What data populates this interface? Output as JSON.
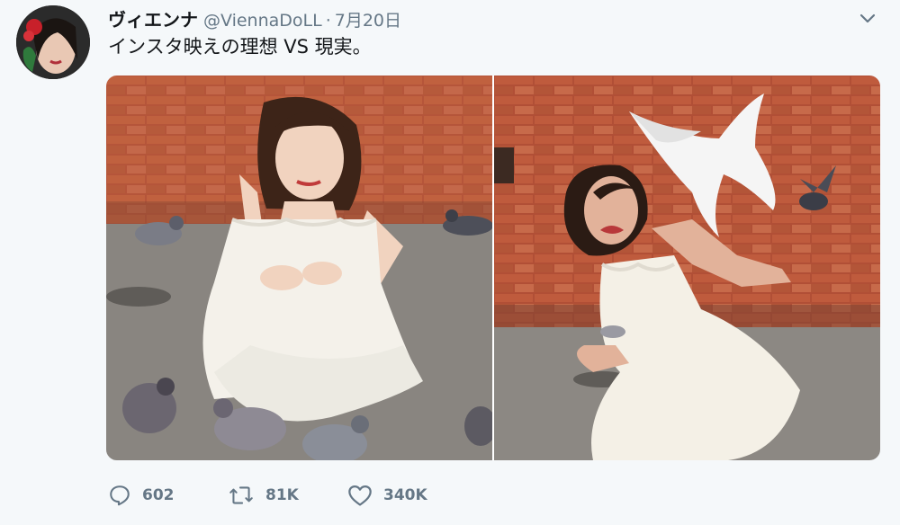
{
  "tweet": {
    "display_name": "ヴィエンナ",
    "handle": "@ViennaDoLL",
    "separator": "·",
    "date": "7月20日",
    "text": "インスタ映えの理想 VS 現実。"
  },
  "actions": {
    "reply_count": "602",
    "retweet_count": "81K",
    "like_count": "340K"
  },
  "icons": {
    "reply": "reply-icon",
    "retweet": "retweet-icon",
    "like": "heart-icon",
    "menu": "chevron-down-icon"
  },
  "colors": {
    "background": "#f5f8fa",
    "text": "#14171a",
    "secondary_text": "#657786"
  }
}
